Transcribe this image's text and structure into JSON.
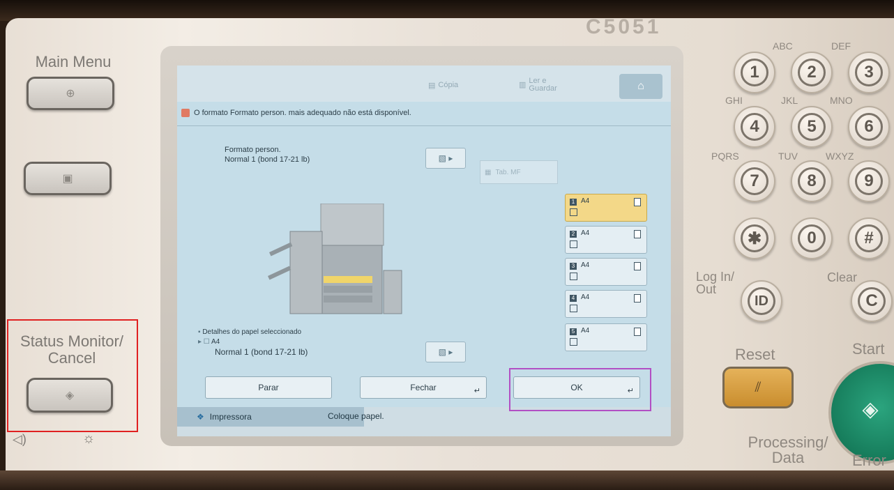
{
  "device": {
    "model": "C5051"
  },
  "left_panel": {
    "main_menu_label": "Main Menu",
    "status_monitor_label": "Status Monitor/\nCancel"
  },
  "screen": {
    "tabs": [
      {
        "label": "Cópia"
      },
      {
        "label": "Ler e\nGuardar"
      }
    ],
    "message": "O formato Formato person. mais adequado não está disponível.",
    "paper_format": {
      "line1": "Formato person.",
      "line2": "Normal 1 (bond 17-21 lb)"
    },
    "tab_mf_label": "Tab. MF",
    "drawers": [
      {
        "num": "1",
        "size": "A4",
        "selected": true
      },
      {
        "num": "2",
        "size": "A4",
        "selected": false
      },
      {
        "num": "3",
        "size": "A4",
        "selected": false
      },
      {
        "num": "4",
        "size": "A4",
        "selected": false
      },
      {
        "num": "5",
        "size": "A4",
        "selected": false
      }
    ],
    "selected_paper": {
      "heading": "Detalhes do papel seleccionado",
      "size": "A4",
      "type": "Normal 1 (bond 17-21 lb)"
    },
    "buttons": {
      "stop": "Parar",
      "close": "Fechar",
      "ok": "OK"
    },
    "status_bar": {
      "device_name": "Impressora",
      "status_text": "Coloque papel."
    }
  },
  "keypad": {
    "keys": [
      "1",
      "2",
      "3",
      "4",
      "5",
      "6",
      "7",
      "8",
      "9",
      "✱",
      "0",
      "#"
    ],
    "letters": [
      "ABC",
      "DEF",
      "GHI",
      "JKL",
      "MNO",
      "PQRS",
      "TUV",
      "WXYZ"
    ],
    "login_label": "Log In/\nOut",
    "id_key": "ID",
    "clear_label": "Clear",
    "clear_key": "C",
    "reset_label": "Reset",
    "start_label": "Start",
    "processing_label": "Processing/\nData",
    "error_label": "Error"
  },
  "colors": {
    "highlight_red": "#e02020",
    "highlight_purple": "#b24fc4",
    "selected_drawer": "#f3d888",
    "start_button": "#0d6b4c",
    "reset_button": "#e5b25a"
  }
}
